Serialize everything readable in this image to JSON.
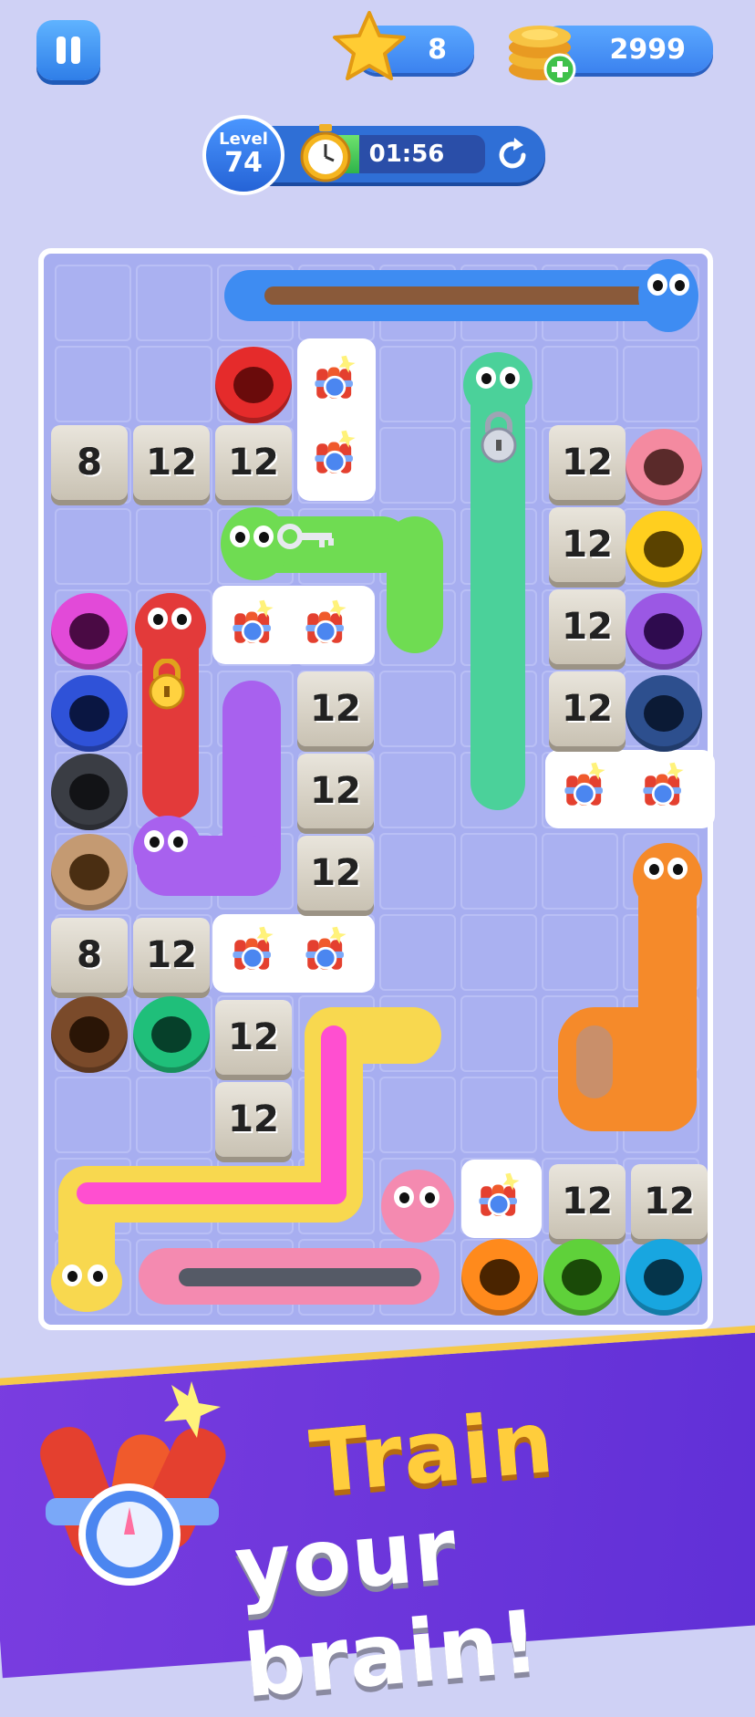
{
  "hud": {
    "stars": "8",
    "coins": "2999",
    "level_label": "Level",
    "level_number": "74",
    "timer": "01:56",
    "timer_progress": 0.2
  },
  "board": {
    "stone_blocks": [
      {
        "value": "8"
      },
      {
        "value": "12"
      },
      {
        "value": "12"
      },
      {
        "value": "12"
      },
      {
        "value": "12"
      },
      {
        "value": "12"
      },
      {
        "value": "12"
      },
      {
        "value": "12"
      },
      {
        "value": "12"
      },
      {
        "value": "12"
      },
      {
        "value": "8"
      },
      {
        "value": "12"
      },
      {
        "value": "12"
      },
      {
        "value": "12"
      },
      {
        "value": "12"
      },
      {
        "value": "12"
      }
    ],
    "colors": {
      "blue_worm": "#3e8cf2",
      "green_worm": "#4bd19a",
      "lime_worm": "#6fdc52",
      "red_worm": "#e33a3a",
      "purple_worm": "#a861ee",
      "orange_worm": "#f58a2a",
      "yellow_worm": "#f8d84f",
      "pink_worm": "#f48ab0"
    }
  },
  "promo": {
    "line1": "Train",
    "line2": "your brain!"
  }
}
